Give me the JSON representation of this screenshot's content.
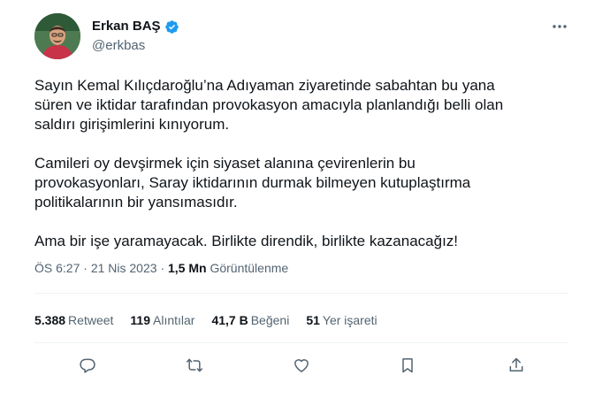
{
  "author": {
    "name": "Erkan BAŞ",
    "handle": "@erkbas",
    "verified": true
  },
  "tweet": {
    "paragraphs": [
      "Sayın Kemal Kılıçdaroğlu’na Adıyaman ziyaretinde sabahtan bu yana\nsüren ve iktidar tarafından provokasyon amacıyla planlandığı belli olan\nsaldırı girişimlerini kınıyorum.",
      "Camileri oy devşirmek için siyaset alanına çevirenlerin bu\nprovokasyonları, Saray iktidarının durmak bilmeyen kutuplaştırma\npolitikalarının bir yansımasıdır.",
      "Ama bir işe yaramayacak. Birlikte direndik, birlikte kazanacağız!"
    ],
    "time": "ÖS 6:27",
    "separator": "·",
    "date": "21 Nis 2023",
    "views_count": "1,5 Mn",
    "views_label": "Görüntülenme"
  },
  "stats": [
    {
      "count": "5.388",
      "label": "Retweet"
    },
    {
      "count": "119",
      "label": "Alıntılar"
    },
    {
      "count": "41,7 B",
      "label": "Beğeni"
    },
    {
      "count": "51",
      "label": "Yer işareti"
    }
  ],
  "icons": {
    "more": "more-horizontal-icon",
    "reply": "reply-icon",
    "retweet": "retweet-icon",
    "like": "heart-icon",
    "bookmark": "bookmark-icon",
    "share": "share-icon",
    "verified": "verified-badge-icon"
  },
  "colors": {
    "text": "#0f1419",
    "secondary": "#536471",
    "verified": "#1d9bf0",
    "divider": "#eff3f4"
  }
}
